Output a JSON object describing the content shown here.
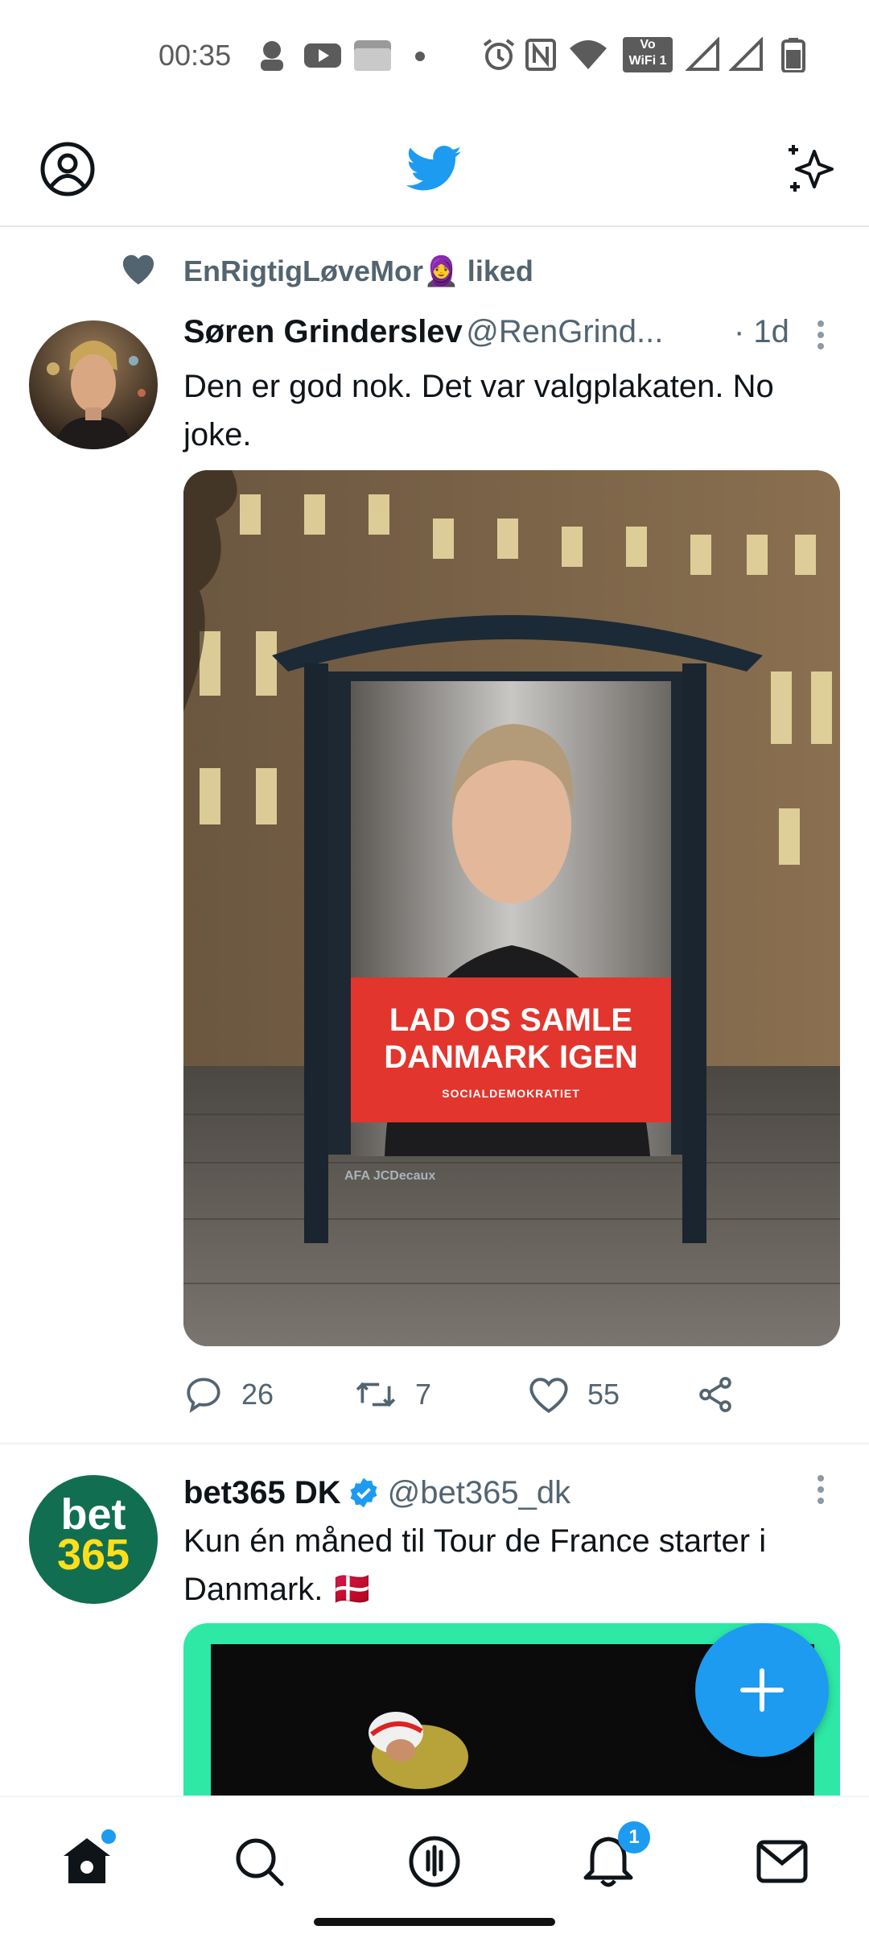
{
  "status_bar": {
    "time": "00:35",
    "volte_top": "Vo",
    "volte_bottom": "WiFi 1",
    "icons": [
      "profile-dot-icon",
      "youtube-icon",
      "photo-icon",
      "dot-icon",
      "alarm-icon",
      "nfc-icon",
      "wifi-icon",
      "volte-wifi-icon",
      "signal-icon",
      "signal-icon",
      "battery-icon"
    ]
  },
  "header": {
    "logo": "twitter-bird-icon",
    "left_icon": "profile-icon",
    "right_icon": "sparkle-icon"
  },
  "tweets": [
    {
      "social_context": "EnRigtigLøveMor🧕 liked",
      "name": "Søren Grinderslev",
      "handle": "@RenGrind...",
      "time": "· 1d",
      "text": "Den er god nok. Det var valgplakaten. No joke.",
      "poster_line1": "LAD OS SAMLE",
      "poster_line2": "DANMARK IGEN",
      "poster_party": "SOCIALDEMOKRATIET",
      "poster_credit": "AFA JCDecaux",
      "replies": "26",
      "retweets": "7",
      "likes": "55"
    },
    {
      "name": "bet365 DK",
      "handle": "@bet365_dk",
      "text": "Kun én måned til Tour de France starter i Danmark. 🇩🇰",
      "avatar_line1": "bet",
      "avatar_line2": "365"
    }
  ],
  "colors": {
    "accent": "#1d9bf0",
    "text": "#0f1419",
    "secondary": "#536471",
    "poster_red": "#e2352d",
    "bet_green": "#126e51",
    "bet_yellow": "#ffdf1b",
    "card_green": "#2ee8a6"
  },
  "bottom_nav": {
    "items": [
      "home-icon",
      "search-icon",
      "spaces-icon",
      "notifications-icon",
      "messages-icon"
    ],
    "notification_count": "1"
  }
}
